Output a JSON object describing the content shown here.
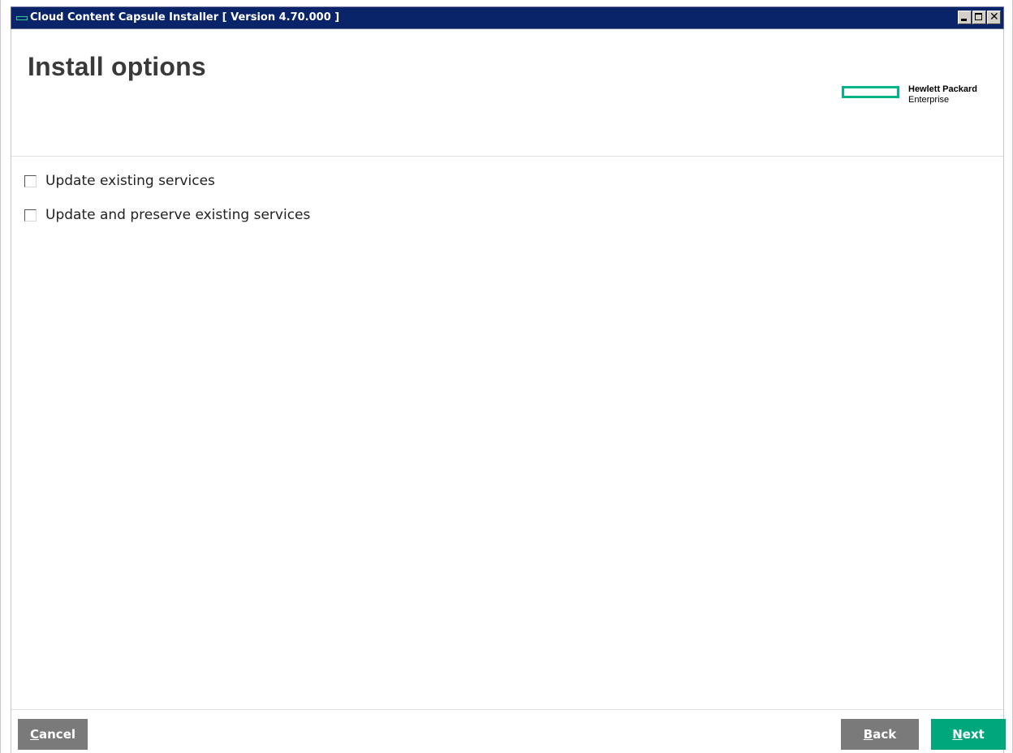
{
  "window": {
    "title": "Cloud Content Capsule Installer [ Version 4.70.000 ]",
    "title_bar_color": "#0a246a",
    "controls": [
      "minimize-icon",
      "maximize-icon",
      "close-icon"
    ]
  },
  "header": {
    "title": "Install options",
    "logo": {
      "line1": "Hewlett Packard",
      "line2": "Enterprise",
      "accent_color": "#00b388"
    }
  },
  "options": [
    {
      "label": "Update existing services",
      "checked": false
    },
    {
      "label": "Update and preserve existing services",
      "checked": false
    }
  ],
  "footer": {
    "cancel": {
      "underline": "C",
      "rest": "ancel"
    },
    "back": {
      "underline": "B",
      "rest": "ack"
    },
    "next": {
      "underline": "N",
      "rest": "ext",
      "color": "#00a77c"
    }
  }
}
